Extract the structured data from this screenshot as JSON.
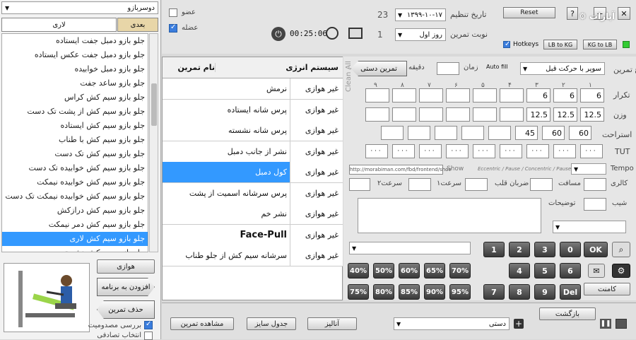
{
  "left": {
    "muscle_select": "دوسربازو",
    "tab_next": "بعدی",
    "tab_lari": "لاری",
    "exercises": [
      {
        "label": "جلو بازو دمبل جفت ایستاده",
        "selected": false
      },
      {
        "label": "جلو بازو دمبل جفت عکس ایستاده",
        "selected": false
      },
      {
        "label": "جلو بازو دمبل خوابیده",
        "selected": false
      },
      {
        "label": "جلو بازو ساعد جفت",
        "selected": false
      },
      {
        "label": "جلو بازو سیم کش کراس",
        "selected": false
      },
      {
        "label": "جلو بازو سیم کش از پشت تک دست",
        "selected": false
      },
      {
        "label": "جلو بازو سیم کش ایستاده",
        "selected": false
      },
      {
        "label": "جلو بازو سیم کش با طناب",
        "selected": false
      },
      {
        "label": "جلو بازو سیم کش تک دست",
        "selected": false
      },
      {
        "label": "جلو بازو سیم کش خوابیده تک دست",
        "selected": false
      },
      {
        "label": "جلو بازو سیم کش خوابیده نیمکت",
        "selected": false
      },
      {
        "label": "جلو بازو سیم کش خوابیده نیمکت تک دست",
        "selected": false
      },
      {
        "label": "جلو بازو سیم کش درازکش",
        "selected": false
      },
      {
        "label": "جلو بازو سیم کش دمر نیمکت",
        "selected": false
      },
      {
        "label": "جلو بازو سیم کش لاری",
        "selected": true
      },
      {
        "label": "جلو بازو سیم کش نشسته",
        "selected": false
      }
    ],
    "aerobic_btn": "هوازی",
    "add_btn": "افزودن به برنامه",
    "remove_btn": "حذف تمرین",
    "check_validity": "بررسی مصدومیت",
    "random_select": "انتخاب تصادفی"
  },
  "top": {
    "member_label": "عضو",
    "muscle_label": "عضله",
    "timer": "00:25:06",
    "count_23": "23",
    "count_1": "1",
    "date_label": "تاریخ تنظیم",
    "date_value": "۱۳۹۹-۱۰-۱۷",
    "turn_label": "نوبت تمرین",
    "turn_value": "روز اول",
    "reset": "Reset",
    "hotkeys": "Hotkeys",
    "lb_to_kg": "LB to KG",
    "kg_to_lb": "KG to LB",
    "help": "?",
    "brand": "آپارات"
  },
  "table": {
    "col_sys": "سیستم انرژی",
    "col_name": "نام تمرین",
    "rows": [
      {
        "sys": "غیر هوازی",
        "name": "نرمش",
        "selected": false
      },
      {
        "sys": "غیر هوازی",
        "name": "پرس شانه ایستاده",
        "selected": false
      },
      {
        "sys": "غیر هوازی",
        "name": "پرس شانه نشسته",
        "selected": false
      },
      {
        "sys": "غیر هوازی",
        "name": "نشر از جانب دمبل",
        "selected": false
      },
      {
        "sys": "غیر هوازی",
        "name": "کول دمبل",
        "selected": true
      },
      {
        "sys": "غیر هوازی",
        "name": "پرس سرشانه اسمیت از پشت",
        "selected": false
      },
      {
        "sys": "غیر هوازی",
        "name": "نشر خم",
        "selected": false
      },
      {
        "sys": "غیر هوازی",
        "name": "Face-Pull",
        "selected": false
      },
      {
        "sys": "غیر هوازی",
        "name": "سرشانه سیم کش از جلو طناب",
        "selected": false
      }
    ]
  },
  "form": {
    "exercise_type_label": "نوع تمرین",
    "exercise_type_value": "سوپر با حرکت قبل",
    "time_label": "زمان",
    "minute_label": "دقیقه",
    "auto_fill": "Auto fill",
    "manual_btn": "تمرین دستی",
    "clean_all": "Clean All",
    "clean": "Clean",
    "set_numbers": [
      "۱",
      "۲",
      "۳",
      "۴",
      "۵",
      "۶",
      "۷",
      "۸",
      "۹"
    ],
    "reps_label": "تکرار",
    "reps": [
      "6",
      "6",
      "6",
      "",
      "",
      "",
      "",
      "",
      ""
    ],
    "weight_label": "وزن",
    "weights": [
      "12.5",
      "12.5",
      "12.5",
      "",
      "",
      "",
      "",
      "",
      ""
    ],
    "rest_label": "استراحت",
    "rests": [
      "60",
      "60",
      "45",
      "",
      "",
      "",
      "",
      ""
    ],
    "tut_label": "TUT",
    "tut_values": [
      "· · ·",
      "· · ·",
      "· · ·",
      "· · ·",
      "· · ·",
      "· · ·",
      "· · ·",
      "· · ·",
      "· · ·"
    ],
    "tempo_label": "Tempo",
    "tempo_hint": "Eccentric / Pause / Concentric / Pause",
    "show_label": "Show",
    "url": "http://morabiman.com/fbd/frontend/shov",
    "calories_label": "کالری",
    "distance_label": "مسافت",
    "heart_label": "ضربان قلب",
    "speed1_label": "سرعت۱",
    "speed2_label": "سرعت۲",
    "incline_label": "شیب",
    "notes_label": "توضیحات"
  },
  "keypad": {
    "row1": [
      "0",
      "3",
      "2",
      "1"
    ],
    "row2": [
      "6",
      "5",
      "4"
    ],
    "row3": [
      "Del",
      "9",
      "8",
      "7"
    ],
    "ok": "OK",
    "pct_row1": [
      "70%",
      "65%",
      "60%",
      "50%",
      "40%"
    ],
    "pct_row2": [
      "95%",
      "90%",
      "85%",
      "80%",
      "75%"
    ],
    "comment": "کامنت"
  },
  "bottom": {
    "view_exercises": "مشاهده تمرین",
    "size_table": "جدول سایز",
    "analyze": "آنالیز",
    "manual_select": "دستی",
    "back": "بازگشت"
  }
}
